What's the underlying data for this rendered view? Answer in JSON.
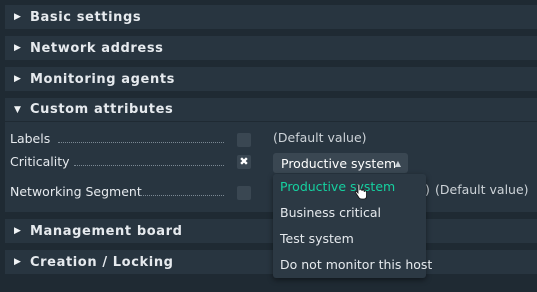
{
  "sections": {
    "basic": "Basic settings",
    "network": "Network address",
    "agents": "Monitoring agents",
    "custom": "Custom attributes",
    "management": "Management board",
    "creation": "Creation / Locking"
  },
  "custom": {
    "labels_label": "Labels",
    "labels_default": "(Default value)",
    "criticality_label": "Criticality",
    "criticality_value": "Productive system",
    "networking_label": "Networking Segment",
    "networking_default": "(Default value)",
    "networking_paren": ")"
  },
  "dropdown": {
    "options": [
      "Productive system",
      "Business critical",
      "Test system",
      "Do not monitor this host"
    ]
  },
  "colors": {
    "active_option": "#15d1a0",
    "panel": "#283540",
    "background": "#1f2a33"
  },
  "icons": {
    "section_collapsed": "triangle-right-icon",
    "section_expanded": "triangle-down-icon",
    "check": "x-mark-icon",
    "caret": "caret-up-icon",
    "cursor": "hand-pointer-icon"
  }
}
